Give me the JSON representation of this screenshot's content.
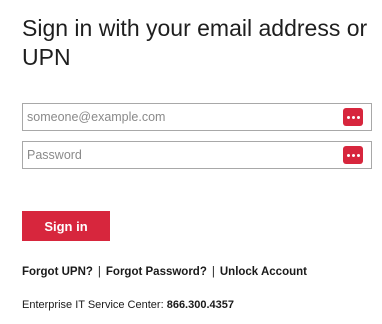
{
  "title": "Sign in with your email address or UPN",
  "email_field": {
    "placeholder": "someone@example.com",
    "value": ""
  },
  "password_field": {
    "placeholder": "Password",
    "value": ""
  },
  "password_manager_icon": "password-manager-icon",
  "sign_in_button": "Sign in",
  "links": {
    "forgot_upn": "Forgot UPN?",
    "forgot_password": "Forgot Password?",
    "unlock_account": "Unlock Account",
    "separator": "|"
  },
  "service_center": {
    "label": "Enterprise IT Service Center:",
    "phone": "866.300.4357"
  },
  "colors": {
    "accent": "#d7263d",
    "border": "#a8a8a8",
    "text": "#1a1a1a"
  }
}
